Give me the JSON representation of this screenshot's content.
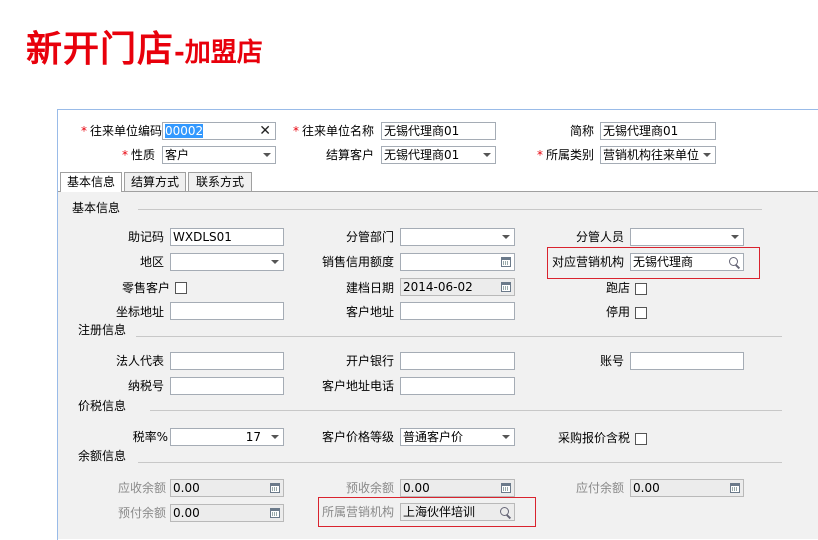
{
  "title": {
    "main": "新开门店",
    "sub": "-加盟店"
  },
  "header": {
    "code_label": "往来单位编码",
    "code_value": "00002",
    "name_label": "往来单位名称",
    "name_value": "无锡代理商01",
    "abbr_label": "简称",
    "abbr_value": "无锡代理商01",
    "nature_label": "性质",
    "nature_value": "客户",
    "settle_label": "结算客户",
    "settle_value": "无锡代理商01",
    "category_label": "所属类别",
    "category_value": "营销机构往来单位"
  },
  "tabs": [
    "基本信息",
    "结算方式",
    "联系方式"
  ],
  "sections": {
    "basic": "基本信息",
    "register": "注册信息",
    "tax": "价税信息",
    "balance": "余额信息"
  },
  "basic": {
    "mnemonic_label": "助记码",
    "mnemonic_value": "WXDLS01",
    "dept_label": "分管部门",
    "dept_value": "",
    "staff_label": "分管人员",
    "staff_value": "",
    "region_label": "地区",
    "region_value": "",
    "credit_label": "销售信用额度",
    "credit_value": "",
    "org_label": "对应营销机构",
    "org_value": "无锡代理商",
    "retail_label": "零售客户",
    "date_label": "建档日期",
    "date_value": "2014-06-02",
    "store_label": "跑店",
    "coord_label": "坐标地址",
    "coord_value": "",
    "address_label": "客户地址",
    "address_value": "",
    "disabled_label": "停用"
  },
  "register": {
    "legal_label": "法人代表",
    "legal_value": "",
    "bank_label": "开户银行",
    "bank_value": "",
    "account_label": "账号",
    "account_value": "",
    "taxno_label": "纳税号",
    "taxno_value": "",
    "phone_label": "客户地址电话",
    "phone_value": ""
  },
  "tax": {
    "rate_label": "税率%",
    "rate_value": "17",
    "price_label": "客户价格等级",
    "price_value": "普通客户价",
    "purchase_label": "采购报价含税"
  },
  "balance": {
    "receivable_label": "应收余额",
    "receivable_value": "0.00",
    "prereceive_label": "预收余额",
    "prereceive_value": "0.00",
    "payable_label": "应付余额",
    "payable_value": "0.00",
    "prepay_label": "预付余额",
    "prepay_value": "0.00",
    "belong_label": "所属营销机构",
    "belong_value": "上海伙伴培训"
  },
  "colors": {
    "title": "#e8000b",
    "highlight_box": "#d9232e",
    "required": "#e8000b"
  },
  "icons": [
    "clear-icon",
    "dropdown-icon",
    "calendar-icon",
    "search-icon"
  ]
}
